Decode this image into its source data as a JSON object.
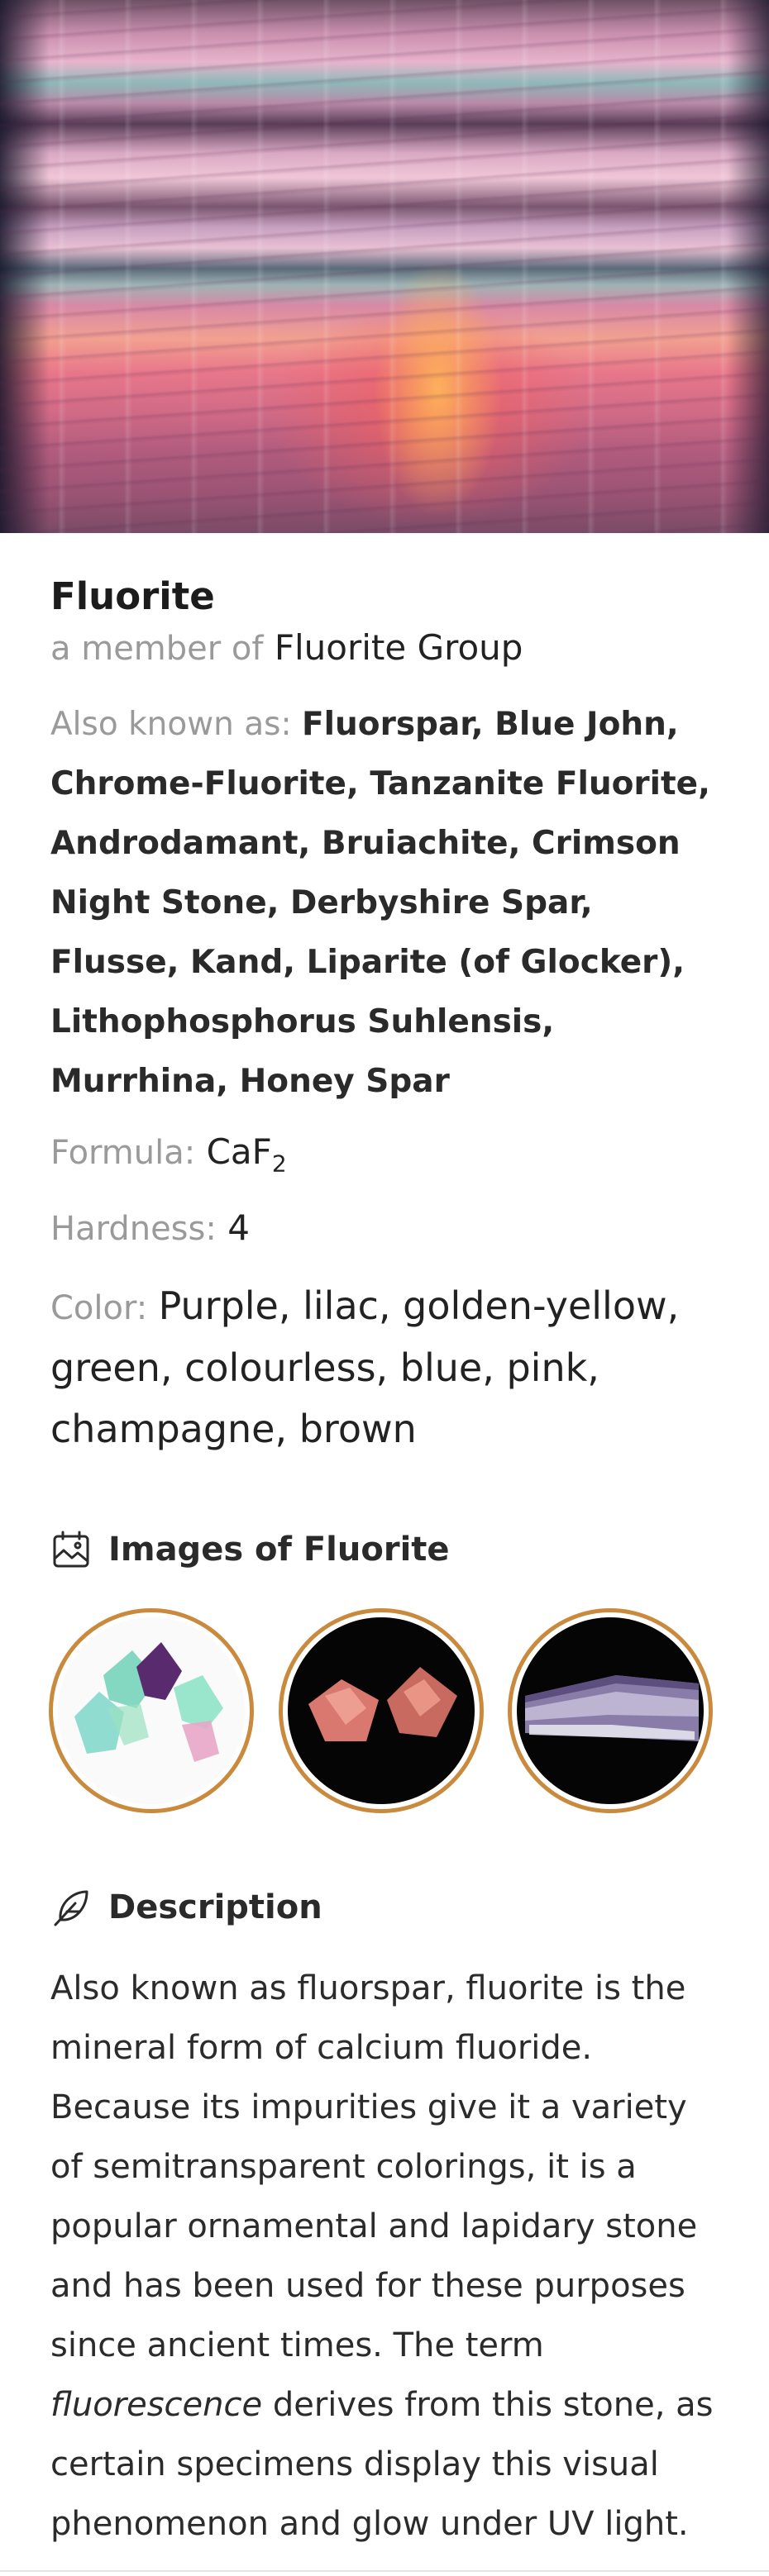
{
  "mineral": {
    "name": "Fluorite",
    "member_prefix": "a member of",
    "group": "Fluorite Group",
    "aka_label": "Also known as:",
    "aka_value": "Fluorspar, Blue John, Chrome-Fluorite, Tanzanite Fluorite, Androdamant, Bruiachite, Crimson Night Stone, Derbyshire Spar, Flusse, Kand, Liparite (of Glocker), Lithophosphorus Suhlensis, Murrhina, Honey Spar",
    "formula_label": "Formula:",
    "formula_main": "CaF",
    "formula_sub": "2",
    "hardness_label": "Hardness:",
    "hardness_value": "4",
    "color_label": "Color:",
    "color_value": "Purple, lilac, golden-yellow, green, colourless, blue, pink, champagne, brown"
  },
  "images_section": {
    "title": "Images of Fluorite",
    "icon": "image-gallery-icon",
    "accent_color": "#c98a3e"
  },
  "description_section": {
    "title": "Description",
    "icon": "feather-pen-icon",
    "text_before": "Also known as fluorspar, fluorite is the mineral form of calcium fluoride. Because its impurities give it a variety of semitransparent colorings, it is a popular ornamental and lapidary stone and has been used for these purposes since ancient times. The term ",
    "text_italic": "fluorescence",
    "text_after": " derives from this stone, as certain specimens display this visual phenomenon and glow under UV light."
  }
}
